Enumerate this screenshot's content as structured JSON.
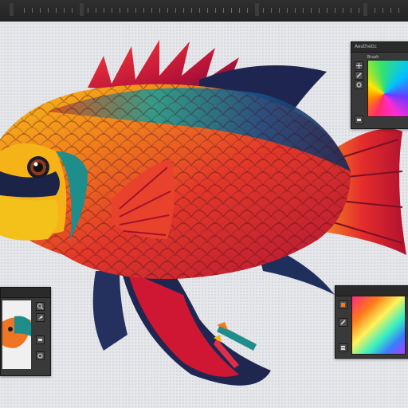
{
  "toolbar": {
    "title": ""
  },
  "panels": {
    "top_right": {
      "title": "Aesthetic",
      "label": "Brush"
    },
    "bottom_left": {
      "title": ""
    },
    "bottom_right": {
      "title": ""
    }
  },
  "icons": [
    "move-icon",
    "brush-icon",
    "eyedropper-icon",
    "eraser-icon",
    "color-picker-icon",
    "zoom-icon",
    "pen-icon"
  ],
  "colors": {
    "canvas": "#e6e7eb",
    "panel": "#393939",
    "panel_header": "#2a2a2a",
    "accent_orange": "#f27a1a",
    "accent_red": "#d8202a",
    "accent_teal": "#1f9e93"
  }
}
